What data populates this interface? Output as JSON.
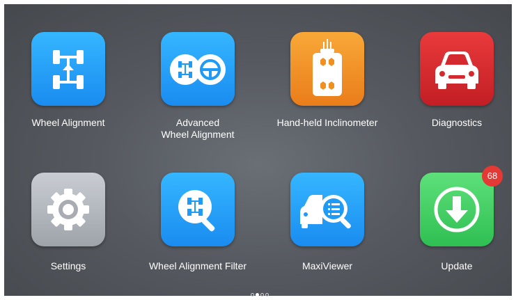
{
  "apps": [
    {
      "label": "Wheel Alignment",
      "icon": "wheel-alignment-icon",
      "color": "#1f9af5"
    },
    {
      "label_line1": "Advanced",
      "label_line2": "Wheel Alignment",
      "icon": "advanced-wheel-alignment-icon",
      "color": "#1f9af5"
    },
    {
      "label": "Hand-held Inclinometer",
      "icon": "inclinometer-icon",
      "color": "#f0901f"
    },
    {
      "label": "Diagnostics",
      "icon": "car-icon",
      "color": "#d42a2f"
    },
    {
      "label": "Settings",
      "icon": "gear-icon",
      "color": "#b1b5bc"
    },
    {
      "label": "Wheel Alignment Filter",
      "icon": "alignment-filter-icon",
      "color": "#1f9af5"
    },
    {
      "label": "MaxiViewer",
      "icon": "maxiviewer-icon",
      "color": "#1f9af5"
    },
    {
      "label": "Update",
      "icon": "download-arrow-icon",
      "color": "#3ccf62"
    }
  ],
  "update_badge": "68",
  "pager": {
    "pages": 3,
    "current": 2
  }
}
